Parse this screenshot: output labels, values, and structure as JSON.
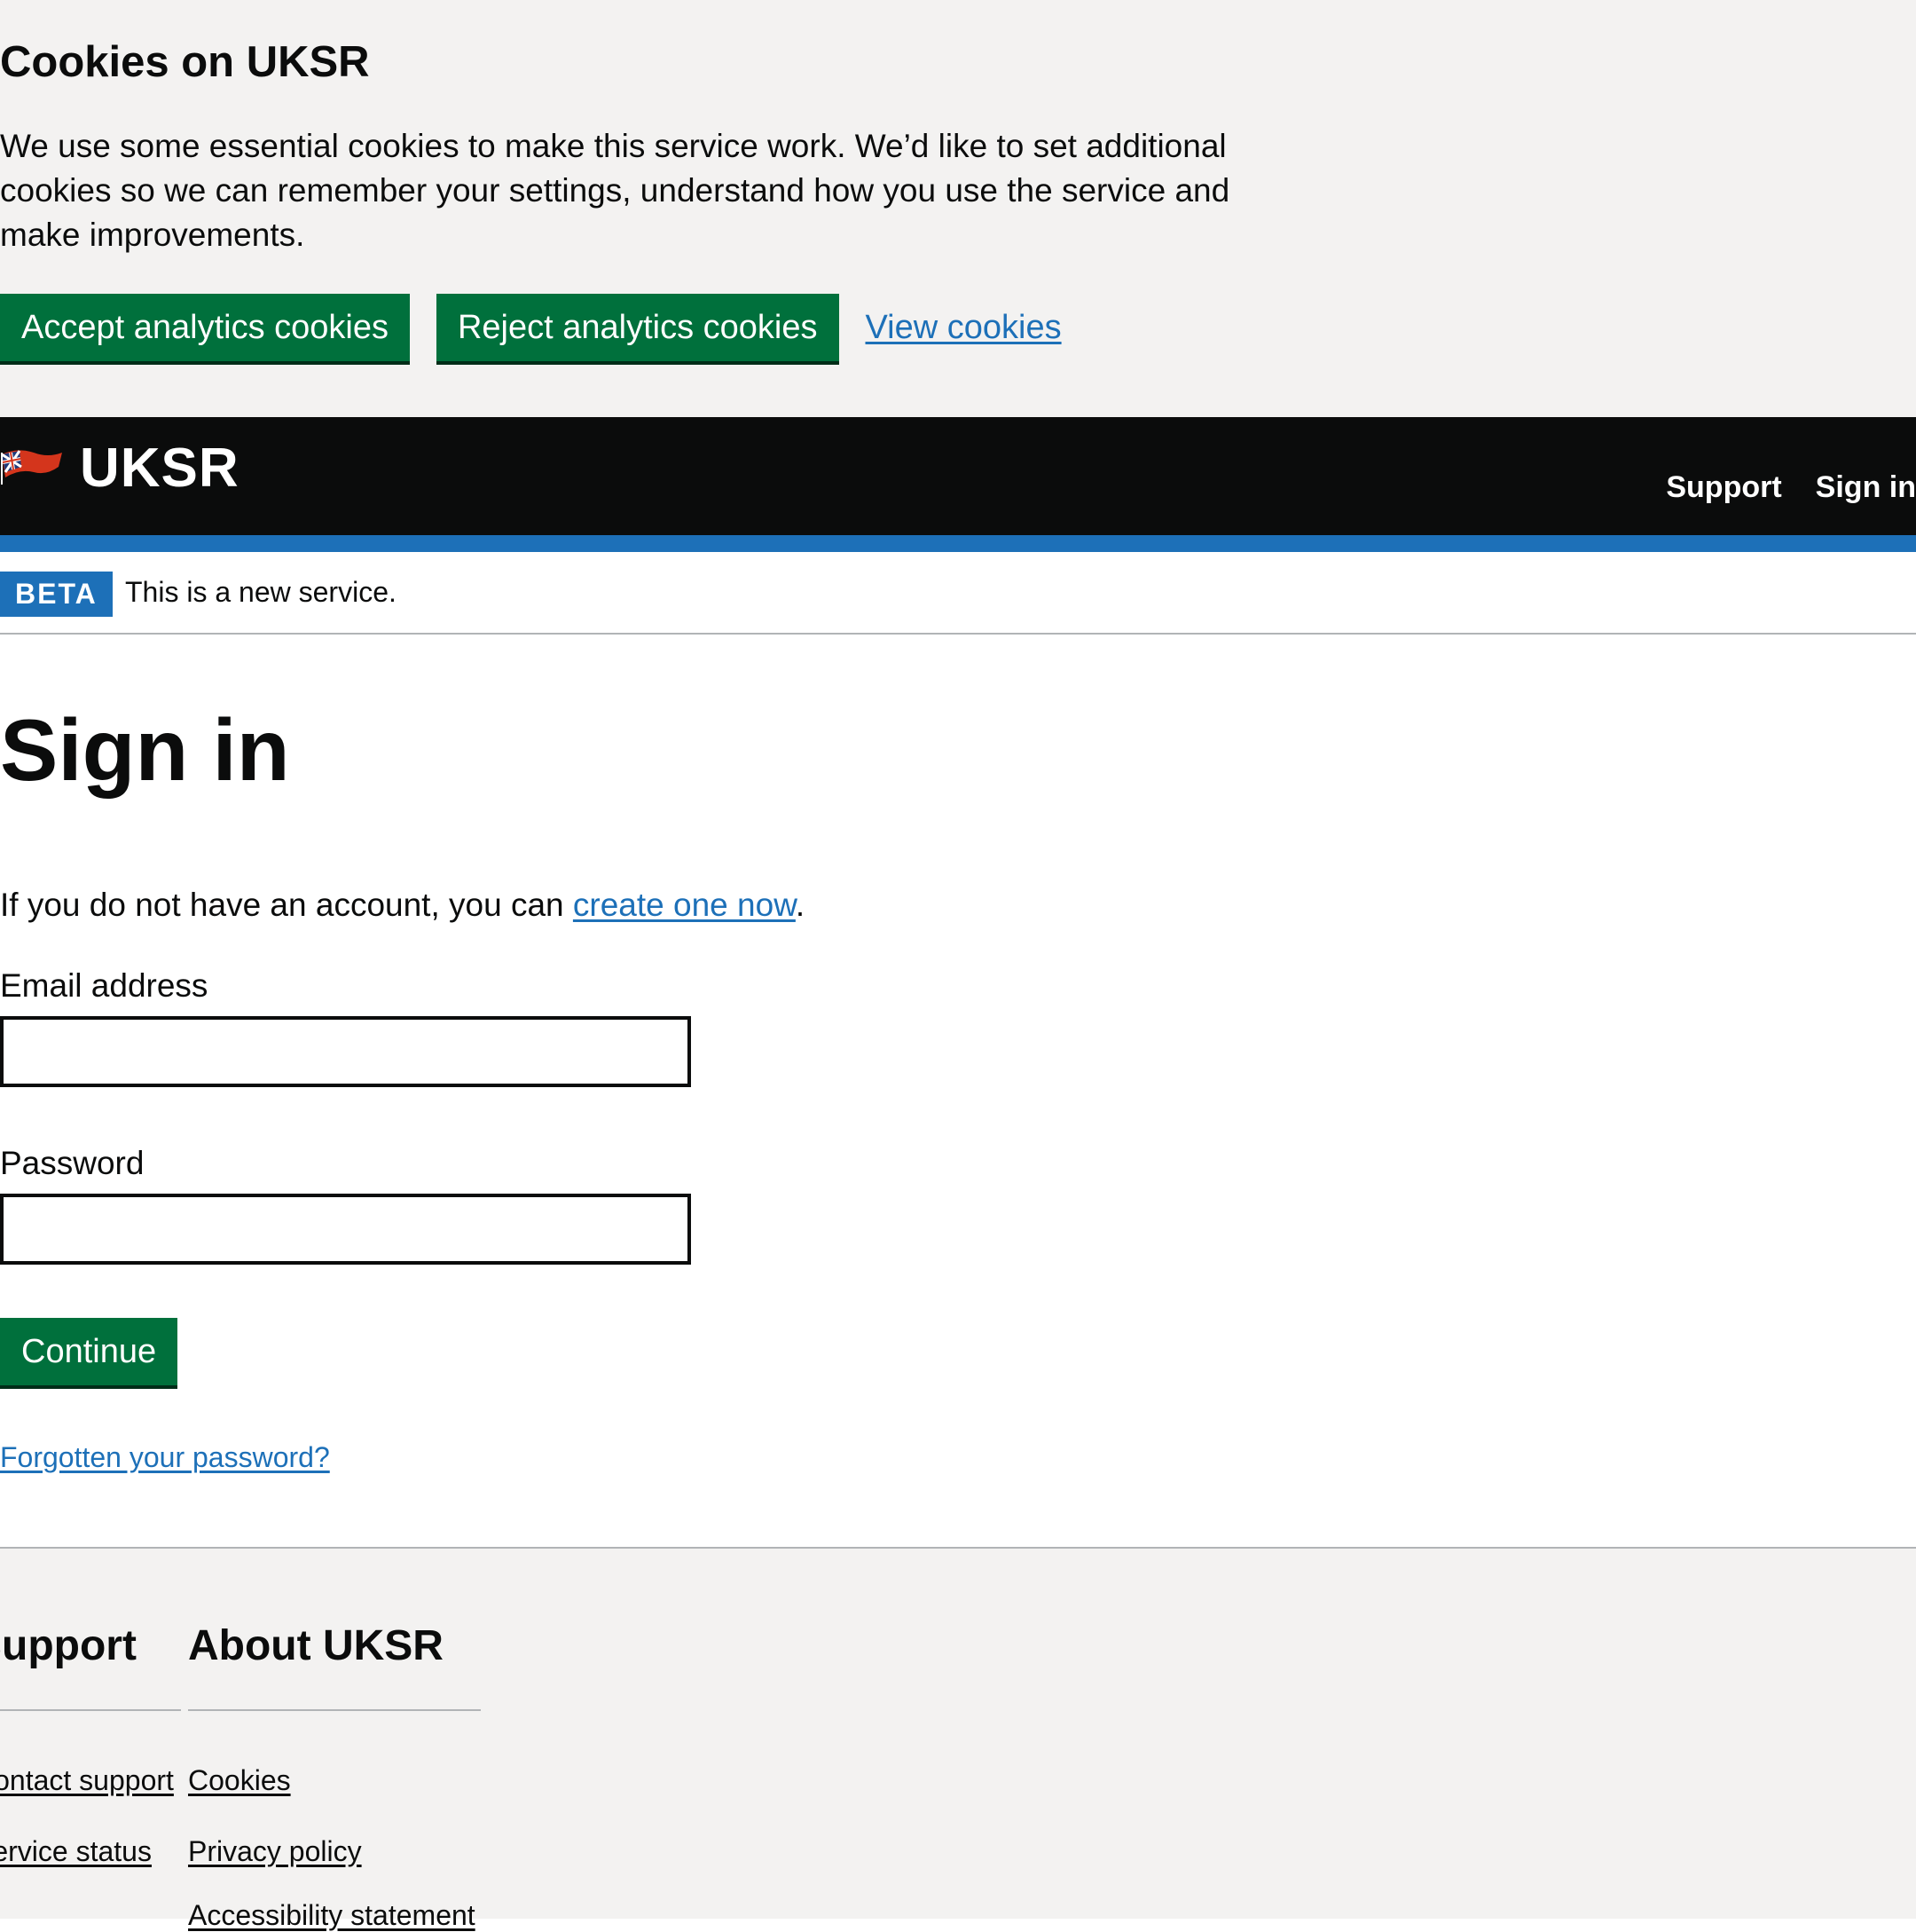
{
  "cookie_banner": {
    "title": "Cookies on UKSR",
    "text": "We use some essential cookies to make this service work. We’d like to set additional cookies so we can remember your settings, understand how you use the service and make improvements.",
    "accept_label": "Accept analytics cookies",
    "reject_label": "Reject analytics cookies",
    "view_label": "View cookies"
  },
  "header": {
    "logo_icon": "red-ensign-flag-icon",
    "service_name": "UKSR",
    "nav": [
      "Support",
      "Sign in"
    ]
  },
  "phase_banner": {
    "tag": "BETA",
    "text": "This is a new service."
  },
  "main": {
    "title": "Sign in",
    "intro_prefix": "If you do not have an account, you can ",
    "intro_link": "create one now",
    "intro_suffix": ".",
    "email_label": "Email address",
    "email_value": "",
    "password_label": "Password",
    "password_value": "",
    "continue_label": "Continue",
    "forgot_link": "Forgotten your password?"
  },
  "footer": {
    "support_heading": "Support",
    "support_links": [
      "Contact support",
      "Service status"
    ],
    "about_heading": "About UKSR",
    "about_links": [
      "Cookies",
      "Privacy policy",
      "Accessibility statement"
    ]
  },
  "colors": {
    "button_green": "#00703c",
    "link_blue": "#1d70b8",
    "header_black": "#0b0c0c",
    "banner_grey": "#f3f2f1"
  }
}
